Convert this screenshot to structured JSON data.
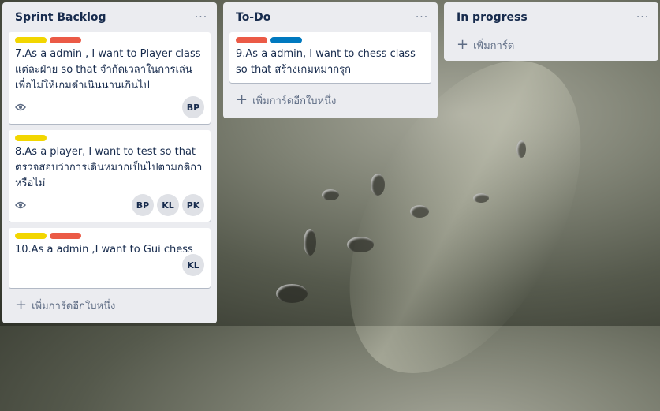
{
  "colors": {
    "yellow": "#f2d600",
    "red": "#eb5a46",
    "blue": "#0079bf"
  },
  "lists": [
    {
      "title": "Sprint Backlog",
      "menu": "···",
      "add_label": "เพิ่มการ์ดอีกใบหนึ่ง",
      "cards": [
        {
          "labels": [
            "yellow",
            "red"
          ],
          "text": "7.As a admin , I want to Player class แต่ละฝ่าย so that จำกัดเวลาในการเล่น เพื่อไม่ให้เกมดำเนินนานเกินไป",
          "watch_icon": "eye-icon",
          "members": [
            "BP"
          ]
        },
        {
          "labels": [
            "yellow"
          ],
          "text": "8.As a player, I want to test so that ตรวจสอบว่าการเดินหมากเป็นไปตามกติกาหรือไม่",
          "watch_icon": "eye-icon",
          "members": [
            "BP",
            "KL",
            "PK"
          ]
        },
        {
          "labels": [
            "yellow",
            "red"
          ],
          "text": "10.As a admin ,I want to Gui chess",
          "members": [
            "KL"
          ]
        }
      ]
    },
    {
      "title": "To-Do",
      "menu": "···",
      "add_label": "เพิ่มการ์ดอีกใบหนึ่ง",
      "cards": [
        {
          "labels": [
            "red",
            "blue"
          ],
          "text": "9.As a admin, I want to chess class so that สร้างเกมหมากรุก"
        }
      ]
    },
    {
      "title": "In progress",
      "menu": "···",
      "add_label": "เพิ่มการ์ด"
    }
  ]
}
